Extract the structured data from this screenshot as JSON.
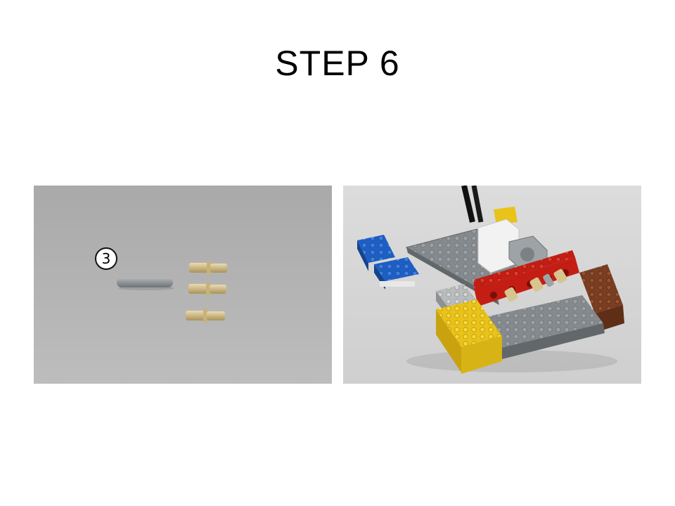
{
  "slide": {
    "title": "STEP 6"
  },
  "parts_photo": {
    "quantity_badge": "3",
    "parts": [
      "axle-grey",
      "connector-peg-tan",
      "connector-peg-tan",
      "connector-peg-tan"
    ]
  },
  "model_photo": {
    "subject": "lego-assembly"
  }
}
